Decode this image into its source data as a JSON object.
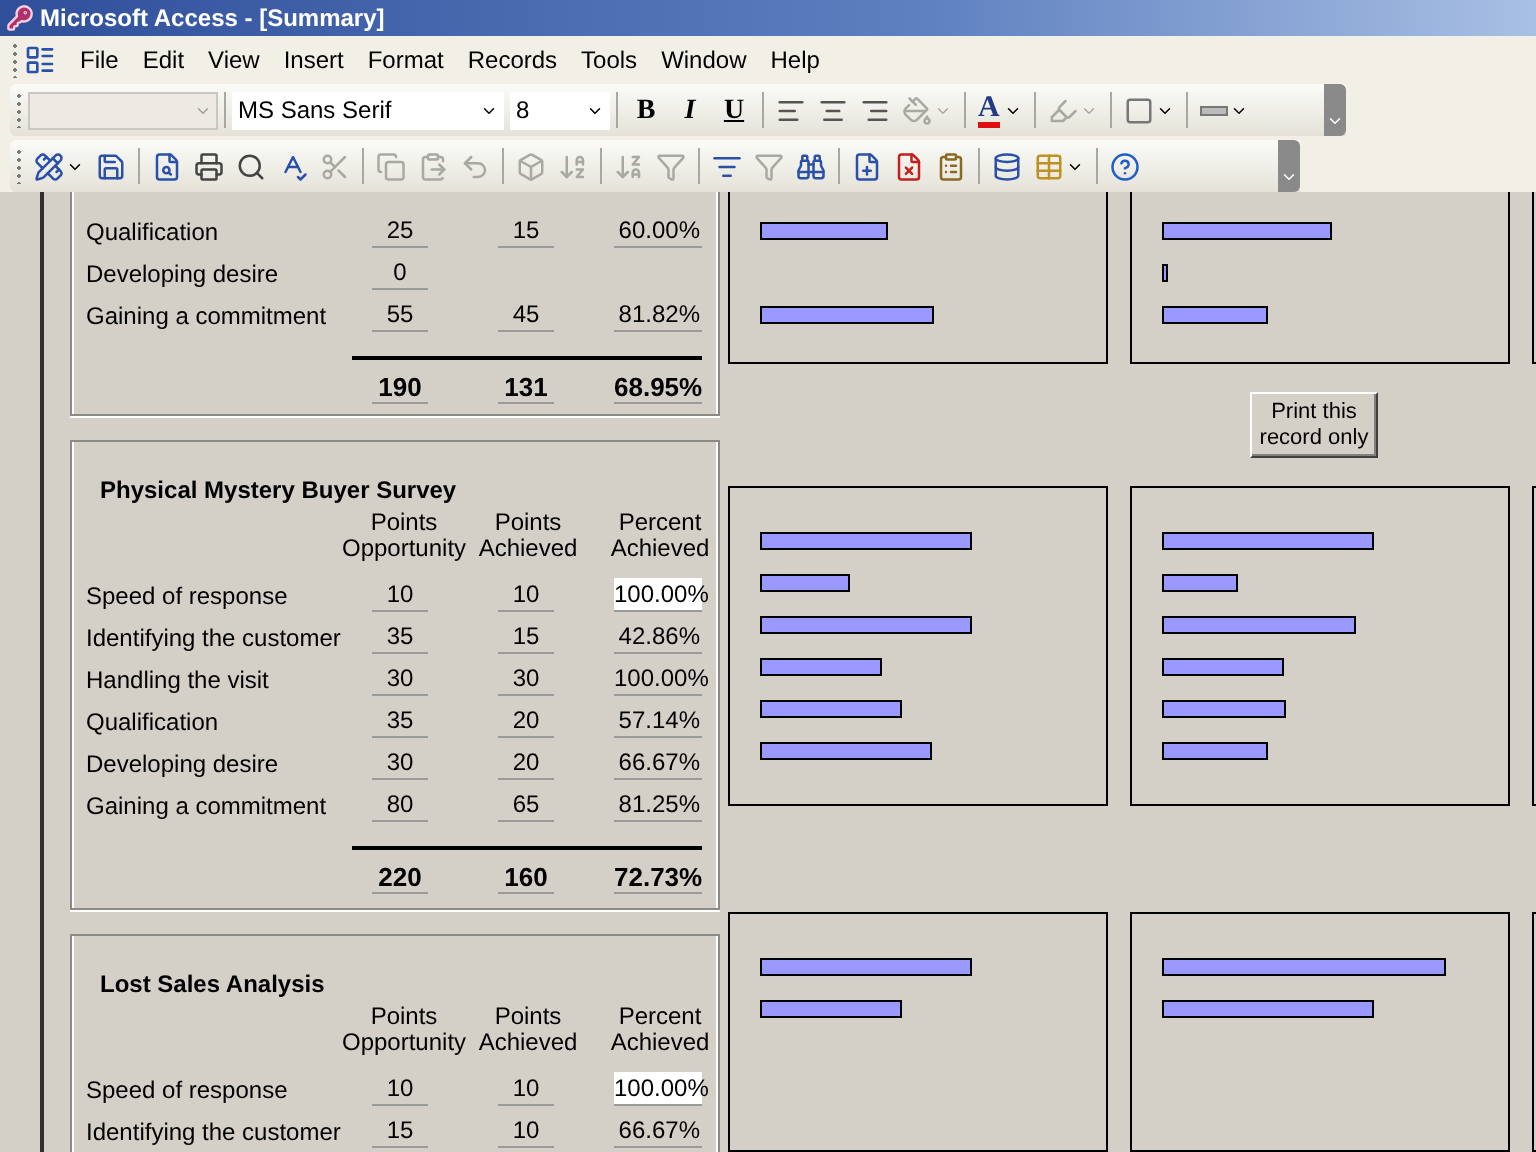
{
  "window": {
    "title": "Microsoft Access - [Summary]"
  },
  "menu": [
    "File",
    "Edit",
    "View",
    "Insert",
    "Format",
    "Records",
    "Tools",
    "Window",
    "Help"
  ],
  "format_toolbar": {
    "font": "MS Sans Serif",
    "size": "8",
    "bold": "B",
    "italic": "I",
    "underline": "U",
    "font_color": "A",
    "tools": [
      {
        "disabled": false
      },
      {
        "disabled": false
      },
      {
        "disabled": false
      },
      {
        "disabled": true
      },
      {
        "disabled": true
      },
      {
        "disabled": false
      },
      {
        "disabled": false
      }
    ]
  },
  "standard_toolbar": [
    {
      "disabled": false
    },
    {
      "disabled": false
    },
    {
      "disabled": false
    },
    {
      "disabled": false
    },
    {
      "disabled": false
    },
    {
      "disabled": false
    },
    {
      "disabled": true
    },
    {
      "disabled": true
    },
    {
      "disabled": true
    },
    {
      "disabled": true
    },
    {
      "disabled": true
    },
    {
      "disabled": true
    },
    {
      "disabled": true
    },
    {
      "disabled": true
    },
    {
      "disabled": false
    },
    {
      "disabled": true
    },
    {
      "disabled": false
    },
    {
      "disabled": false
    },
    {
      "disabled": false
    },
    {
      "disabled": false
    },
    {
      "disabled": false
    },
    {
      "disabled": false
    },
    {
      "disabled": false
    }
  ],
  "sections": [
    {
      "rows": [
        {
          "label": "Qualification",
          "opportunity": "25",
          "achieved": "15",
          "percent": "60.00%",
          "focused": false
        },
        {
          "label": "Developing desire",
          "opportunity": "0"
        },
        {
          "label": "Gaining a commitment",
          "opportunity": "55",
          "achieved": "45",
          "percent": "81.82%",
          "focused": false
        }
      ],
      "totals": {
        "opportunity": "190",
        "achieved": "131",
        "percent": "68.95%"
      }
    },
    {
      "title": "Physical Mystery Buyer Survey",
      "headers": [
        "Points Opportunity",
        "Points Achieved",
        "Percent Achieved"
      ],
      "rows": [
        {
          "label": "Speed of response",
          "opportunity": "10",
          "achieved": "10",
          "percent": "100.00%",
          "focused": true
        },
        {
          "label": "Identifying the customer",
          "opportunity": "35",
          "achieved": "15",
          "percent": "42.86%",
          "focused": false
        },
        {
          "label": "Handling the visit",
          "opportunity": "30",
          "achieved": "30",
          "percent": "100.00%",
          "focused": false
        },
        {
          "label": "Qualification",
          "opportunity": "35",
          "achieved": "20",
          "percent": "57.14%",
          "focused": false
        },
        {
          "label": "Developing desire",
          "opportunity": "30",
          "achieved": "20",
          "percent": "66.67%",
          "focused": false
        },
        {
          "label": "Gaining a commitment",
          "opportunity": "80",
          "achieved": "65",
          "percent": "81.25%",
          "focused": false
        }
      ],
      "totals": {
        "opportunity": "220",
        "achieved": "160",
        "percent": "72.73%"
      }
    },
    {
      "title": "Lost Sales Analysis",
      "headers": [
        "Points Opportunity",
        "Points Achieved",
        "Percent Achieved"
      ],
      "rows": [
        {
          "label": "Speed of response",
          "opportunity": "10",
          "achieved": "10",
          "percent": "100.00%",
          "focused": true
        },
        {
          "label": "Identifying the customer",
          "opportunity": "15",
          "achieved": "10",
          "percent": "66.67%",
          "focused": false
        }
      ]
    }
  ],
  "print_button": "Print this record only"
}
